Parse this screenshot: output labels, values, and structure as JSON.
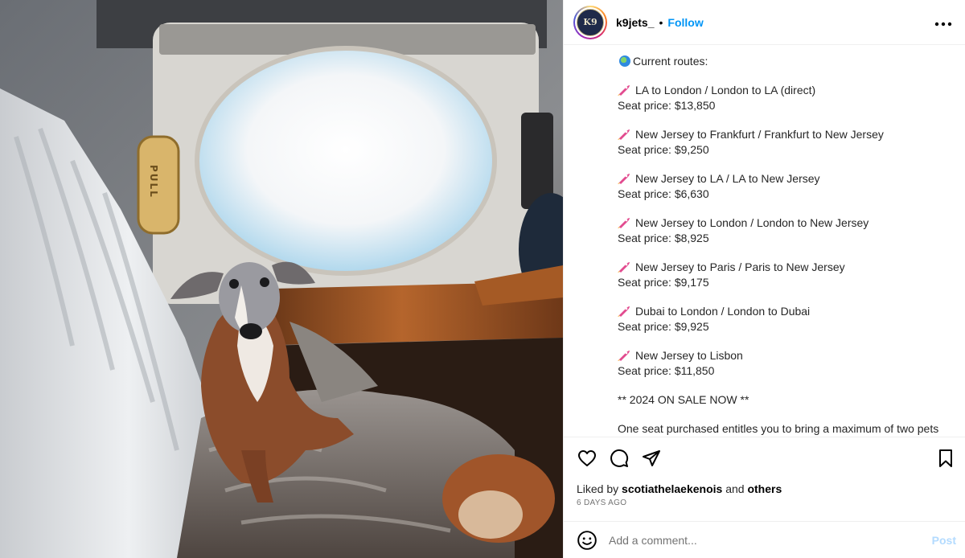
{
  "header": {
    "avatar_text": "K9",
    "username": "k9jets_",
    "separator": "•",
    "follow_label": "Follow",
    "more_label": "•••"
  },
  "photo": {
    "pull_label": "PULL",
    "description_icons": [
      "dog",
      "window",
      "blanket"
    ]
  },
  "caption": {
    "intro": "Current routes:",
    "routes": [
      {
        "route": "LA to London / London to LA (direct)",
        "price": "Seat price: $13,850"
      },
      {
        "route": "New Jersey to Frankfurt / Frankfurt to New Jersey",
        "price": "Seat price: $9,250"
      },
      {
        "route": "New Jersey to LA / LA to New Jersey",
        "price": "Seat price: $6,630"
      },
      {
        "route": "New Jersey to London / London to New Jersey",
        "price": "Seat price: $8,925"
      },
      {
        "route": "New Jersey to Paris / Paris to New Jersey",
        "price": "Seat price: $9,175"
      },
      {
        "route": "Dubai to London / London to Dubai",
        "price": "Seat price: $9,925"
      },
      {
        "route": "New Jersey to Lisbon",
        "price": "Seat price: $11,850"
      }
    ],
    "sale": "** 2024 ON SALE NOW **",
    "footer": "One seat purchased entitles you to bring a maximum of two pets"
  },
  "actions": {
    "icons": [
      "heart-icon",
      "comment-icon",
      "share-icon",
      "bookmark-icon"
    ]
  },
  "likes": {
    "prefix": "Liked by",
    "user": "scotiathelaekenois",
    "conjunction": "and",
    "others": "others"
  },
  "date": "6 DAYS AGO",
  "comment": {
    "placeholder": "Add a comment...",
    "post_label": "Post"
  },
  "colors": {
    "link": "#0095f6",
    "post_disabled": "#b3dbff",
    "muted": "#737373"
  }
}
